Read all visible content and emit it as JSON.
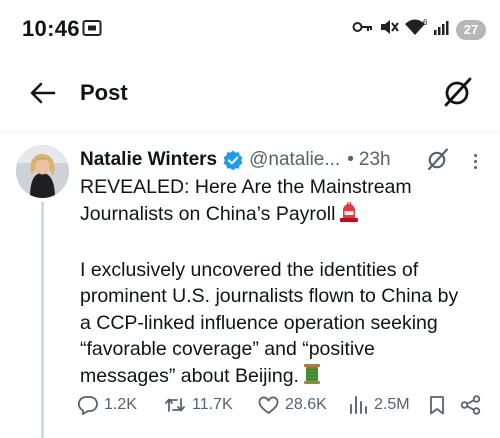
{
  "status_bar": {
    "time": "10:46",
    "battery": "27",
    "icons": [
      "screen-cast-icon",
      "key-icon",
      "mute-icon",
      "wifi-icon",
      "signal-icon",
      "battery-icon"
    ]
  },
  "header": {
    "title": "Post",
    "icons": [
      "back-arrow-icon",
      "grok-icon"
    ]
  },
  "tweet": {
    "author": {
      "name": "Natalie Winters",
      "handle": "@natalie...",
      "verified": true
    },
    "dot": "•",
    "time": "23h",
    "text_lines": [
      "REVEALED: Here Are the Mainstream",
      "Journalists on China’s Payroll",
      "",
      "I exclusively uncovered the identities of",
      "prominent U.S. journalists flown to China by",
      "a CCP-linked influence operation seeking",
      "“favorable coverage” and “positive",
      "messages” about Beijing."
    ],
    "emojis": [
      "rotating-light-emoji",
      "thread-spool-emoji"
    ],
    "stats": {
      "replies": "1.2K",
      "reposts": "11.7K",
      "likes": "28.6K",
      "views": "2.5M"
    }
  },
  "colors": {
    "primary_text": "#0f1419",
    "secondary_text": "#536471",
    "verified_blue": "#1d9bf0",
    "thread_line": "#cfd9de"
  }
}
